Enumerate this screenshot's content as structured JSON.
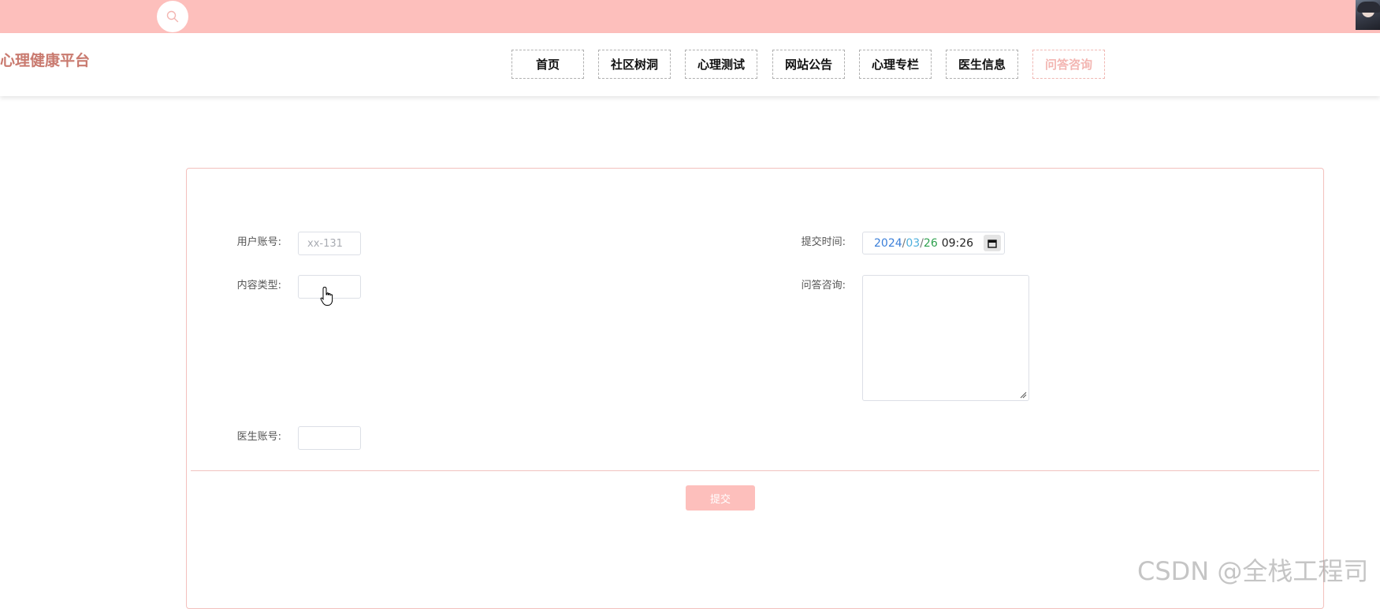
{
  "header": {
    "brand_color": "#fdbfbc",
    "search_icon": "search-icon",
    "avatar": "user-avatar"
  },
  "nav": {
    "logo": "心理健康平台",
    "items": [
      {
        "label": "首页",
        "active": false
      },
      {
        "label": "社区树洞",
        "active": false
      },
      {
        "label": "心理测试",
        "active": false
      },
      {
        "label": "网站公告",
        "active": false
      },
      {
        "label": "心理专栏",
        "active": false
      },
      {
        "label": "医生信息",
        "active": false
      },
      {
        "label": "问答咨询",
        "active": true
      }
    ]
  },
  "form": {
    "user_account": {
      "label": "用户账号:",
      "value": "xx-131"
    },
    "content_type": {
      "label": "内容类型:",
      "value": ""
    },
    "doctor_account": {
      "label": "医生账号:",
      "value": ""
    },
    "submit_time": {
      "label": "提交时间:",
      "year": "2024",
      "month": "03",
      "day": "26",
      "time": "09:26"
    },
    "question": {
      "label": "问答咨询:",
      "value": ""
    },
    "submit_label": "提交"
  },
  "watermark": "CSDN @全栈工程司"
}
